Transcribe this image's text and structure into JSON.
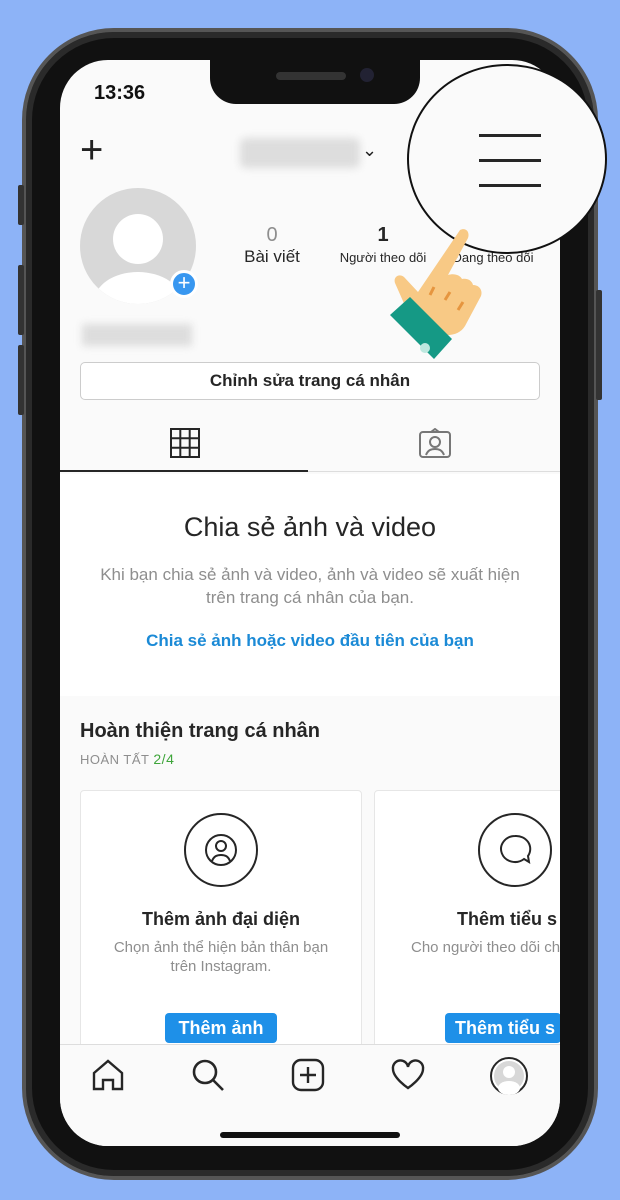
{
  "status": {
    "time": "13:36"
  },
  "header": {
    "username_blurred": true,
    "add_icon": "plus-icon",
    "menu_icon": "hamburger-menu-icon"
  },
  "profile": {
    "stats": [
      {
        "value": "0",
        "label": "Bài viết"
      },
      {
        "value": "1",
        "label": "Người theo dõi"
      },
      {
        "value": "",
        "label": "Đang theo dõi"
      }
    ],
    "edit_label": "Chỉnh sửa trang cá nhân"
  },
  "tabs": [
    {
      "icon": "grid-icon",
      "active": true
    },
    {
      "icon": "tagged-person-icon",
      "active": false
    }
  ],
  "empty": {
    "title": "Chia sẻ ảnh và video",
    "desc": "Khi bạn chia sẻ ảnh và video, ảnh và video sẽ xuất hiện trên trang cá nhân của bạn.",
    "link": "Chia sẻ ảnh hoặc video đầu tiên của bạn"
  },
  "complete": {
    "title": "Hoàn thiện trang cá nhân",
    "progress_label": "HOÀN TẤT",
    "progress": "2/4",
    "cards": [
      {
        "icon": "user-circle-icon",
        "title": "Thêm ảnh đại diện",
        "desc": "Chọn ảnh thể hiện bản thân bạn trên Instagram.",
        "button": "Thêm ảnh"
      },
      {
        "icon": "speech-bubble-icon",
        "title": "Thêm tiểu s",
        "desc": "Cho người theo dõi chút về bản thân",
        "button": "Thêm tiểu s"
      }
    ]
  },
  "bottom_nav": [
    "home-icon",
    "search-icon",
    "add-post-icon",
    "heart-icon",
    "profile-avatar-icon"
  ],
  "colors": {
    "background": "#8db3f7",
    "accent": "#1e90e8",
    "progress": "#3ea53a"
  }
}
